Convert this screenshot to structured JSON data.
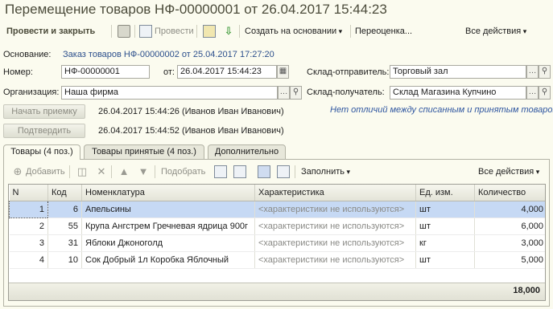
{
  "window": {
    "title": "Перемещение товаров НФ-00000001 от 26.04.2017 15:44:23"
  },
  "toolbar": {
    "post_close": "Провести и закрыть",
    "post": "Провести",
    "create_based": "Создать на основании",
    "revaluation": "Переоценка...",
    "all_actions": "Все действия"
  },
  "header": {
    "basis_label": "Основание:",
    "basis_link": "Заказ товаров НФ-00000002 от 25.04.2017 17:27:20",
    "number_label": "Номер:",
    "number_value": "НФ-00000001",
    "from_label": "от:",
    "date_value": "26.04.2017 15:44:23",
    "org_label": "Организация:",
    "org_value": "Наша фирма",
    "sender_label": "Склад-отправитель:",
    "sender_value": "Торговый зал",
    "receiver_label": "Склад-получатель:",
    "receiver_value": "Склад Магазина Купчино"
  },
  "actions": {
    "start_receiving": "Начать приемку",
    "start_receiving_info": "26.04.2017 15:44:26 (Иванов Иван Иванович)",
    "confirm": "Подтвердить",
    "confirm_info": "26.04.2017 15:44:52 (Иванов Иван Иванович)",
    "no_diff_note": "Нет отличий между списанным и принятым товаром"
  },
  "tabs": [
    {
      "label": "Товары (4 поз.)",
      "active": true
    },
    {
      "label": "Товары принятые (4 поз.)",
      "active": false
    },
    {
      "label": "Дополнительно",
      "active": false
    }
  ],
  "table_toolbar": {
    "add": "Добавить",
    "pick": "Подобрать",
    "fill": "Заполнить",
    "all_actions": "Все действия"
  },
  "table": {
    "columns": [
      "N",
      "Код",
      "Номенклатура",
      "Характеристика",
      "Ед. изм.",
      "Количество"
    ],
    "rows": [
      {
        "n": "1",
        "code": "6",
        "name": "Апельсины",
        "char": "<характеристики не используются>",
        "unit": "шт",
        "qty": "4,000"
      },
      {
        "n": "2",
        "code": "55",
        "name": "Крупа Ангстрем Гречневая ядрица 900г",
        "char": "<характеристики не используются>",
        "unit": "шт",
        "qty": "6,000"
      },
      {
        "n": "3",
        "code": "31",
        "name": "Яблоки Джоноголд",
        "char": "<характеристики не используются>",
        "unit": "кг",
        "qty": "3,000"
      },
      {
        "n": "4",
        "code": "10",
        "name": "Сок Добрый 1л Коробка Яблочный",
        "char": "<характеристики не используются>",
        "unit": "шт",
        "qty": "5,000"
      }
    ],
    "total_qty": "18,000"
  },
  "colors": {
    "title": "#4b4b3a",
    "link": "#2c4f8c",
    "selection": "#c6d9f4",
    "background": "#fbfbef"
  }
}
